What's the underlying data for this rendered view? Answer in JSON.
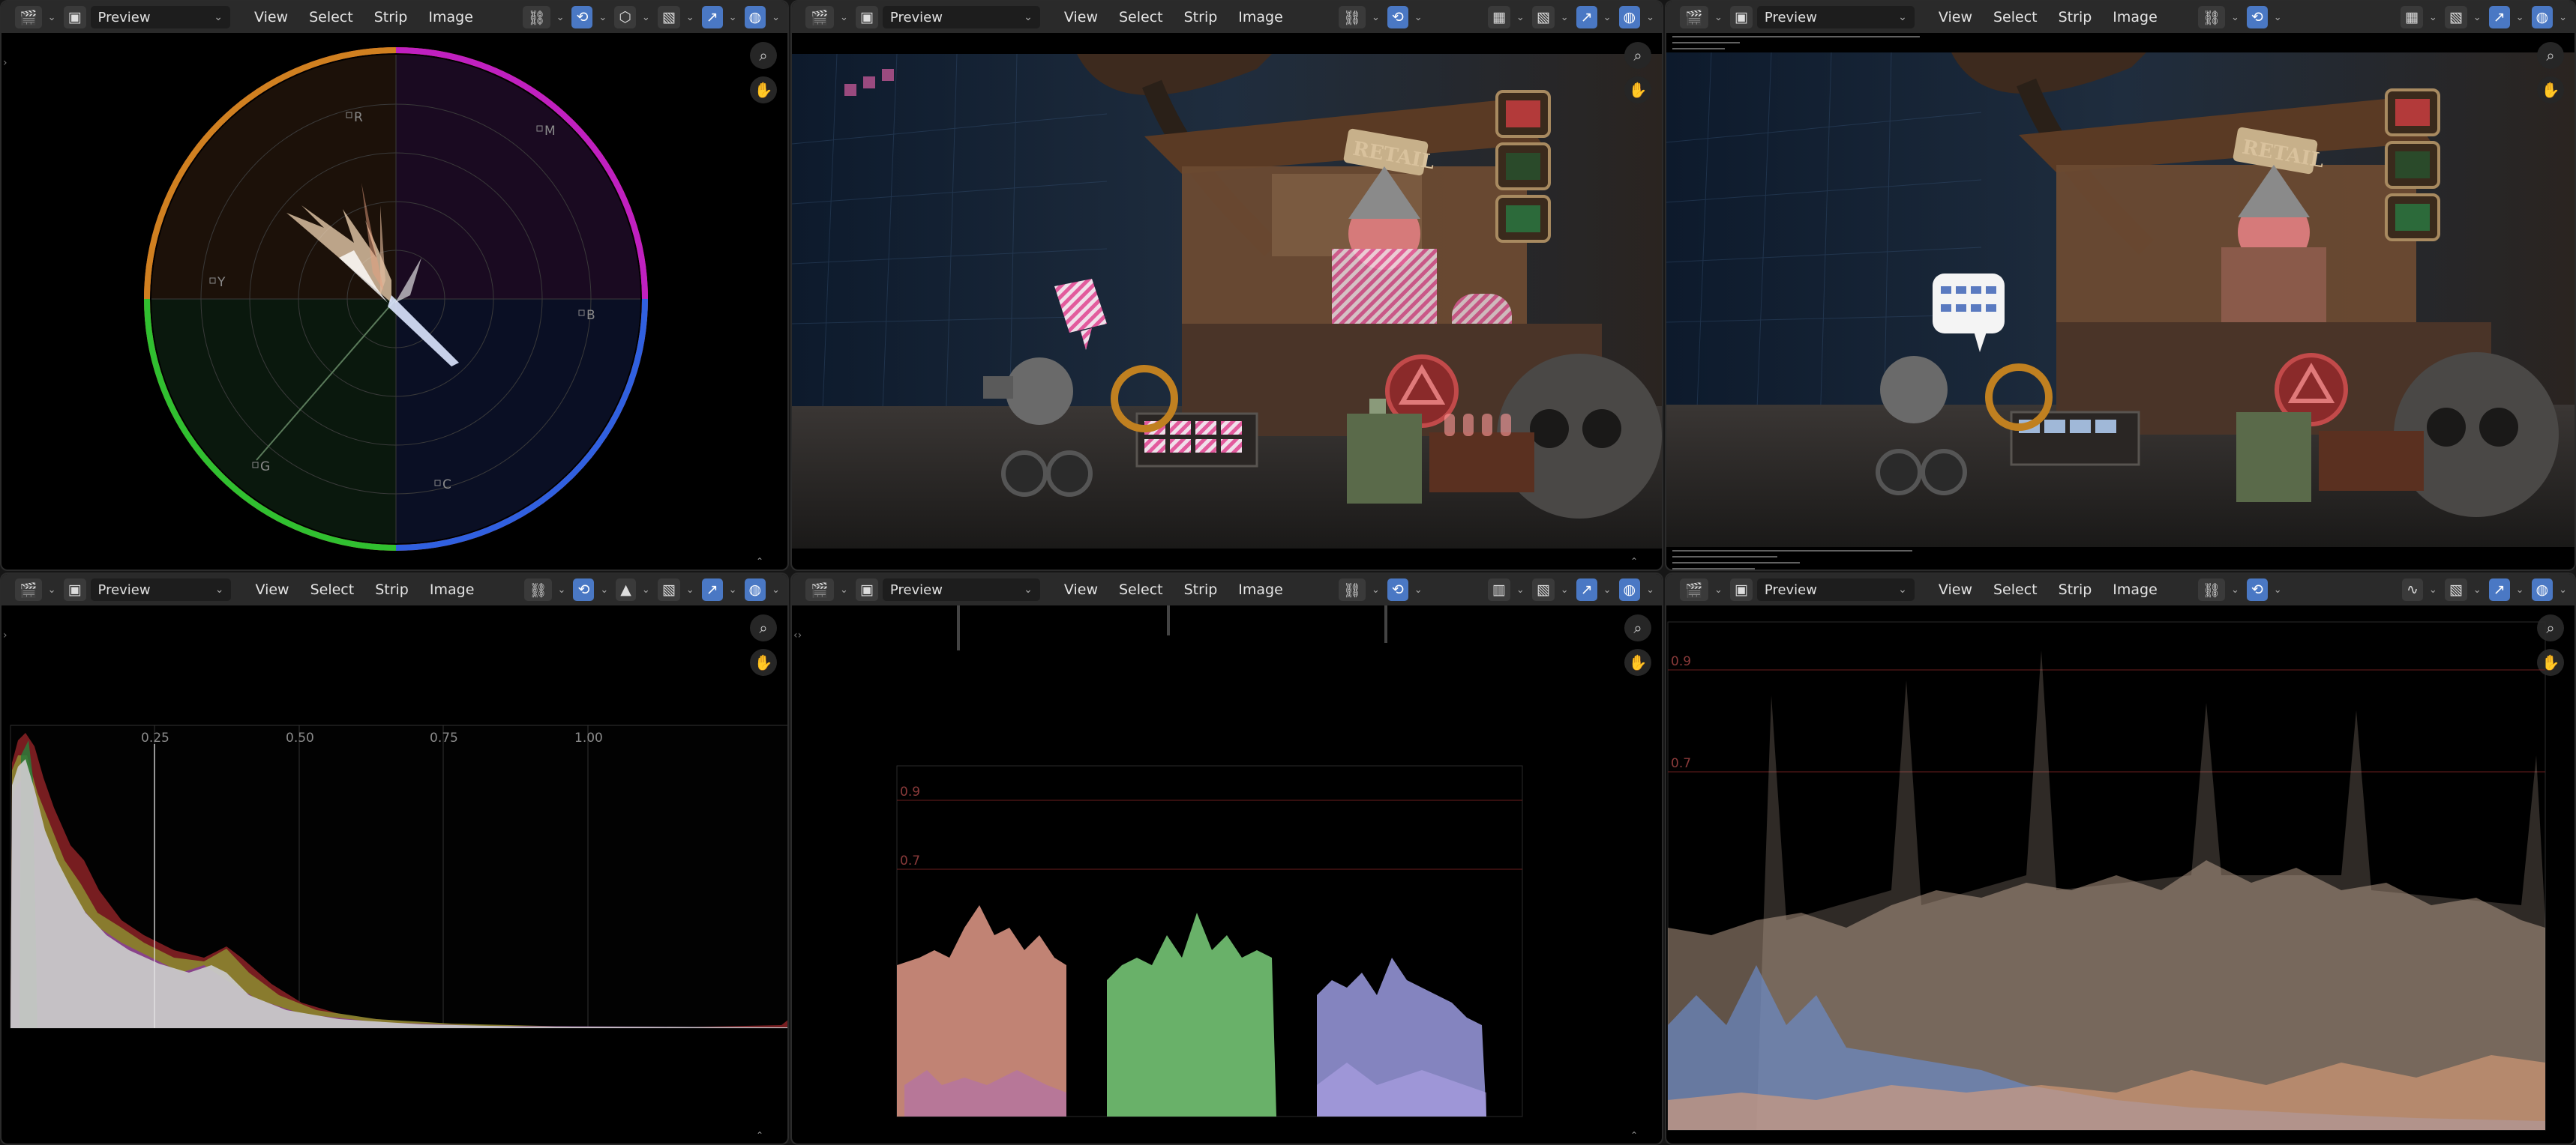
{
  "header": {
    "mode": "Preview",
    "menus": [
      "View",
      "Select",
      "Strip",
      "Image"
    ]
  },
  "scopes": {
    "vectorscope_labels": [
      "R",
      "M",
      "B",
      "C",
      "G",
      "Y"
    ],
    "histogram_ticks": [
      "0.25",
      "0.50",
      "0.75",
      "1.00"
    ],
    "parade_levels": [
      "0.9",
      "0.7"
    ],
    "waveform_levels": [
      "0.9",
      "0.7"
    ]
  },
  "render": {
    "shop_sign": "RETAIL"
  },
  "colors": {
    "accent": "#4a78c4",
    "header_bg": "#2a2a2a",
    "area_bg": "#000000"
  }
}
